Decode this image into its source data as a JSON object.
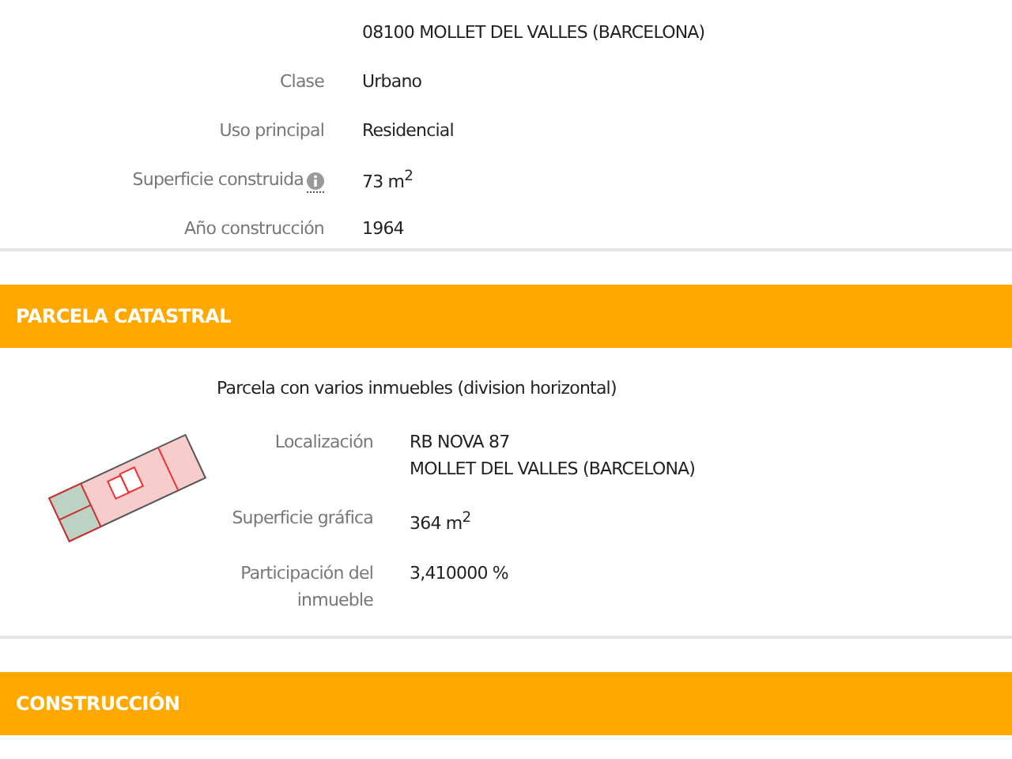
{
  "inmueble": {
    "rows": [
      {
        "label": "",
        "value": "08100 MOLLET DEL VALLES (BARCELONA)",
        "info": false
      },
      {
        "label": "Clase",
        "value": "Urbano",
        "info": false
      },
      {
        "label": "Uso principal",
        "value": "Residencial",
        "info": false
      },
      {
        "label": "Superficie construida",
        "value": "73 m$^{2}$",
        "info": true
      },
      {
        "label": "Año construcción",
        "value": "1964",
        "info": false
      }
    ]
  },
  "parcela": {
    "title": "PARCELA CATASTRAL",
    "description": "Parcela con varios inmuebles (division horizontal)",
    "rows": [
      {
        "label": "Localización",
        "value": [
          "RB NOVA 87",
          "MOLLET DEL VALLES (BARCELONA)"
        ]
      },
      {
        "label": "Superficie gráfica",
        "value": [
          "364 m$^{2}$"
        ]
      },
      {
        "label": "Participación del inmueble",
        "value": [
          "3,410000 %"
        ]
      }
    ]
  },
  "construccion": {
    "title": "CONSTRUCCIÓN"
  }
}
